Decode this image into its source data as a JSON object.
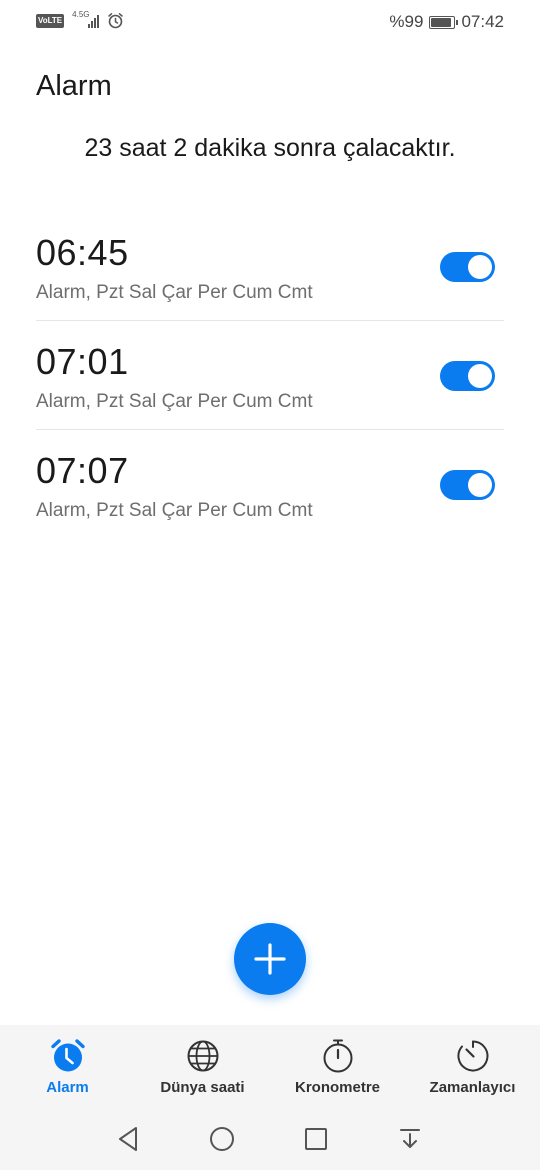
{
  "status_bar": {
    "volte": "VoLTE",
    "network": "4.5G",
    "battery_text": "%99",
    "time": "07:42"
  },
  "header": {
    "title": "Alarm",
    "next_alarm": "23 saat 2 dakika sonra çalacaktır."
  },
  "alarms": [
    {
      "time": "06:45",
      "description": "Alarm, Pzt Sal Çar Per Cum Cmt",
      "enabled": true
    },
    {
      "time": "07:01",
      "description": "Alarm, Pzt Sal Çar Per Cum Cmt",
      "enabled": true
    },
    {
      "time": "07:07",
      "description": "Alarm, Pzt Sal Çar Per Cum Cmt",
      "enabled": true
    }
  ],
  "fab": {
    "icon": "plus-icon"
  },
  "tabs": [
    {
      "label": "Alarm",
      "icon": "alarm-clock-icon",
      "active": true
    },
    {
      "label": "Dünya saati",
      "icon": "globe-icon",
      "active": false
    },
    {
      "label": "Kronometre",
      "icon": "stopwatch-icon",
      "active": false
    },
    {
      "label": "Zamanlayıcı",
      "icon": "timer-icon",
      "active": false
    }
  ],
  "colors": {
    "accent": "#0a7cf0",
    "tab_bar_bg": "#f5f5f5",
    "secondary_text": "#6e6e6e"
  }
}
